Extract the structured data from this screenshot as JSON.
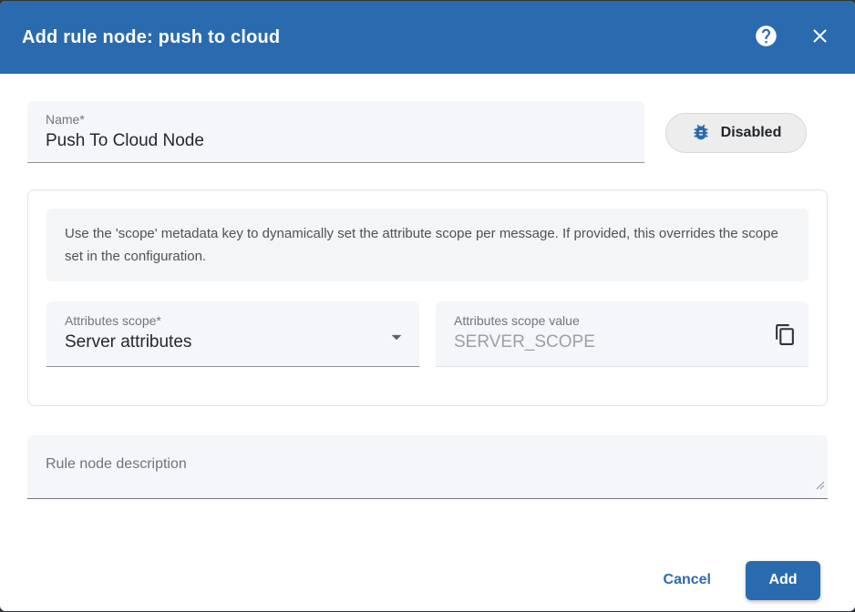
{
  "header": {
    "title": "Add rule node: push to cloud",
    "help_icon": "help-circle",
    "close_icon": "close"
  },
  "name_row": {
    "name_field": {
      "label": "Name*",
      "value": "Push To Cloud Node"
    },
    "debug_chip": {
      "icon": "bug-report",
      "label": "Disabled"
    }
  },
  "config_card": {
    "hint": "Use the 'scope' metadata key to dynamically set the attribute scope per message. If provided, this overrides the scope set in the configuration.",
    "scope_select": {
      "label": "Attributes scope*",
      "value": "Server attributes",
      "icon": "arrow-drop-down"
    },
    "scope_value_field": {
      "label": "Attributes scope value",
      "placeholder": "SERVER_SCOPE",
      "icon": "content-copy"
    }
  },
  "description_field": {
    "placeholder": "Rule node description"
  },
  "footer": {
    "cancel_label": "Cancel",
    "add_label": "Add"
  },
  "colors": {
    "primary": "#2a6baf",
    "header_background": "#2a6baf",
    "field_background": "#f4f6f9",
    "hint_background": "#f4f5f7",
    "chip_background": "#ededee",
    "bug_icon": "#2a6baf"
  }
}
